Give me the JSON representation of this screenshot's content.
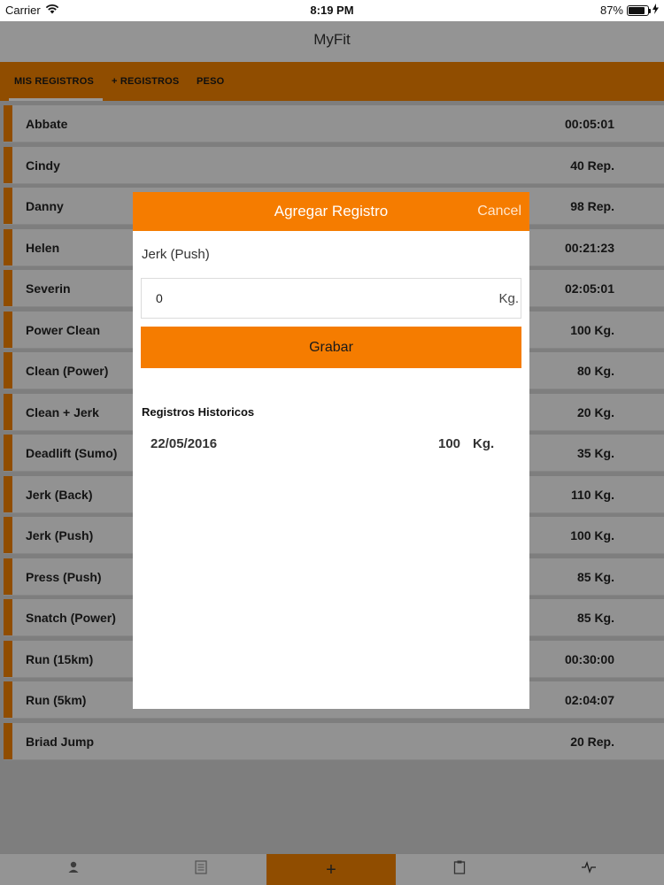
{
  "status_bar": {
    "carrier": "Carrier",
    "time": "8:19 PM",
    "battery": "87%",
    "battery_level": 0.87
  },
  "nav": {
    "title": "MyFit"
  },
  "tabs": [
    {
      "label": "MIS REGISTROS"
    },
    {
      "label": "+ REGISTROS"
    },
    {
      "label": "PESO"
    }
  ],
  "list": [
    {
      "name": "Abbate",
      "value": "00:05:01"
    },
    {
      "name": "Cindy",
      "value": "40  Rep."
    },
    {
      "name": "Danny",
      "value": "98  Rep."
    },
    {
      "name": "Helen",
      "value": "00:21:23"
    },
    {
      "name": "Severin",
      "value": "02:05:01"
    },
    {
      "name": "Power Clean",
      "value": "100  Kg."
    },
    {
      "name": "Clean (Power)",
      "value": "80  Kg."
    },
    {
      "name": "Clean + Jerk",
      "value": "20  Kg."
    },
    {
      "name": "Deadlift (Sumo)",
      "value": "35  Kg."
    },
    {
      "name": "Jerk (Back)",
      "value": "110  Kg."
    },
    {
      "name": "Jerk (Push)",
      "value": "100  Kg."
    },
    {
      "name": "Press (Push)",
      "value": "85  Kg."
    },
    {
      "name": "Snatch (Power)",
      "value": "85  Kg."
    },
    {
      "name": "Run (15km)",
      "value": "00:30:00"
    },
    {
      "name": "Run (5km)",
      "value": "02:04:07"
    },
    {
      "name": "Briad Jump",
      "value": "20  Rep."
    }
  ],
  "modal": {
    "title": "Agregar Registro",
    "cancel": "Cancel",
    "exercise": "Jerk (Push)",
    "input_value": "0",
    "unit": "Kg.",
    "save": "Grabar",
    "history_title": "Registros Historicos",
    "history": [
      {
        "date": "22/05/2016",
        "value": "100",
        "unit": "Kg."
      }
    ]
  },
  "tabbar": {
    "items": [
      {
        "icon": "person-icon"
      },
      {
        "icon": "list-icon"
      },
      {
        "icon": "plus-icon",
        "label": "+"
      },
      {
        "icon": "clipboard-icon"
      },
      {
        "icon": "heartbeat-icon"
      }
    ]
  },
  "colors": {
    "accent": "#f08000",
    "modal_accent": "#f57c00",
    "background": "#f4f4f4"
  }
}
